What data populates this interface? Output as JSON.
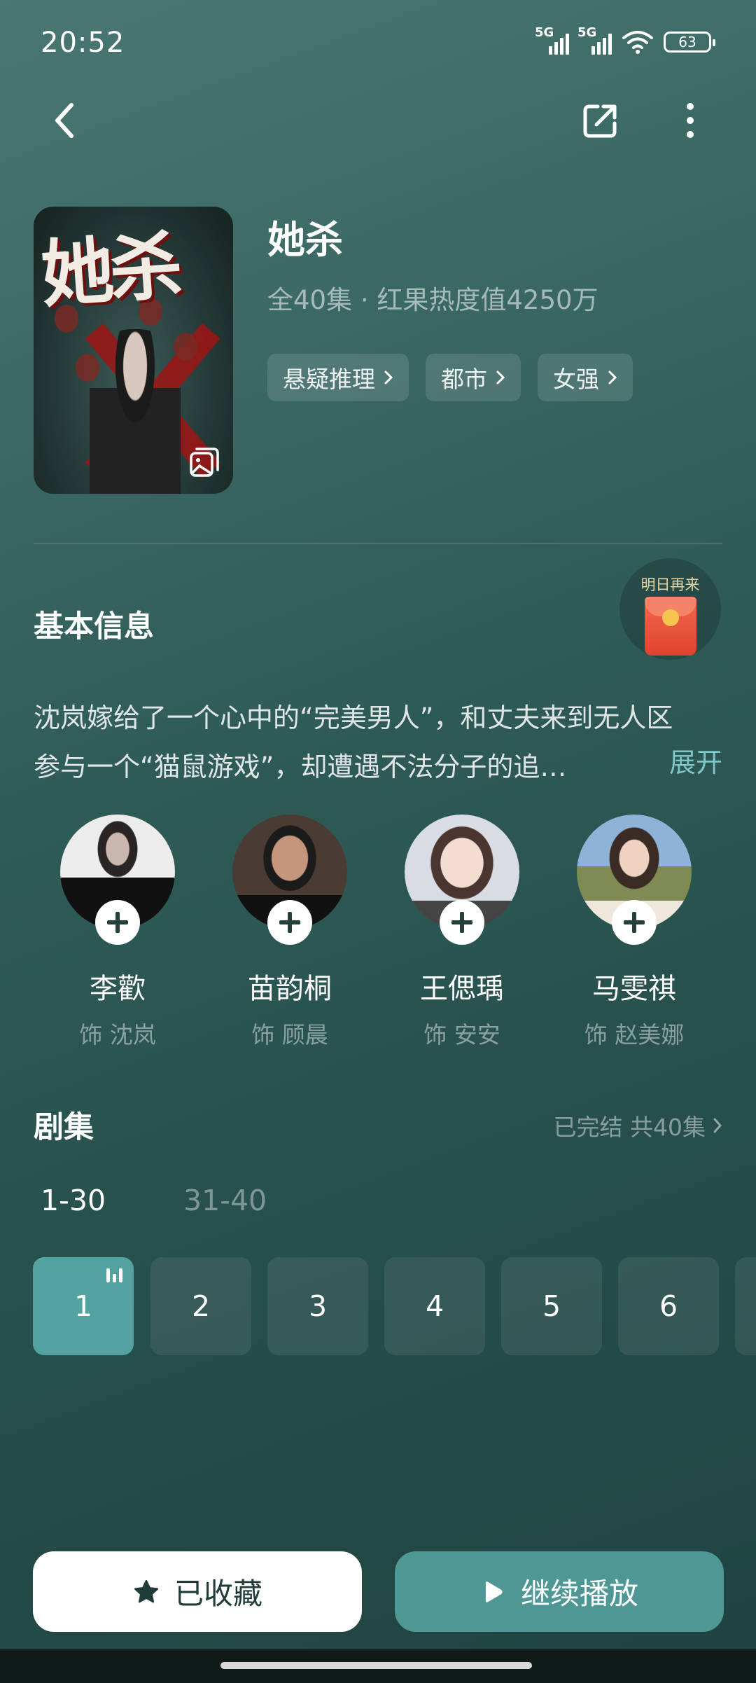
{
  "status_bar": {
    "time": "20:52",
    "network1": "5G",
    "network2": "5G",
    "battery": "63"
  },
  "nav": {
    "back_icon": "chevron-left-icon",
    "share_icon": "share-icon",
    "more_icon": "more-vertical-icon"
  },
  "show": {
    "poster_title": "她杀",
    "title": "她杀",
    "meta": "全40集 · 红果热度值4250万",
    "tags": [
      "悬疑推理",
      "都市",
      "女强"
    ]
  },
  "basic_info": {
    "heading": "基本信息",
    "daily_reward": "明日再来",
    "description_line1": "沈岚嫁给了一个心中的“完美男人”，和丈夫来到无人区",
    "description_line2": "参与一个“猫鼠游戏”，却遭遇不法分子的追…",
    "expand": "展开"
  },
  "cast": [
    {
      "name": "李歡",
      "role": "饰 沈岚"
    },
    {
      "name": "苗韵桐",
      "role": "饰 顾晨"
    },
    {
      "name": "王偲瑀",
      "role": "饰 安安"
    },
    {
      "name": "马雯祺",
      "role": "饰 赵美娜"
    }
  ],
  "episodes": {
    "heading": "剧集",
    "status": "已完结 共40集",
    "ranges": [
      "1-30",
      "31-40"
    ],
    "active_range": "1-30",
    "items": [
      "1",
      "2",
      "3",
      "4",
      "5",
      "6"
    ],
    "current": "1"
  },
  "actions": {
    "collect": "已收藏",
    "play": "继续播放"
  },
  "colors": {
    "accent": "#53a29f",
    "link": "#7fc7c9",
    "background_top": "#4a7772",
    "background_bottom": "#1f4340"
  }
}
